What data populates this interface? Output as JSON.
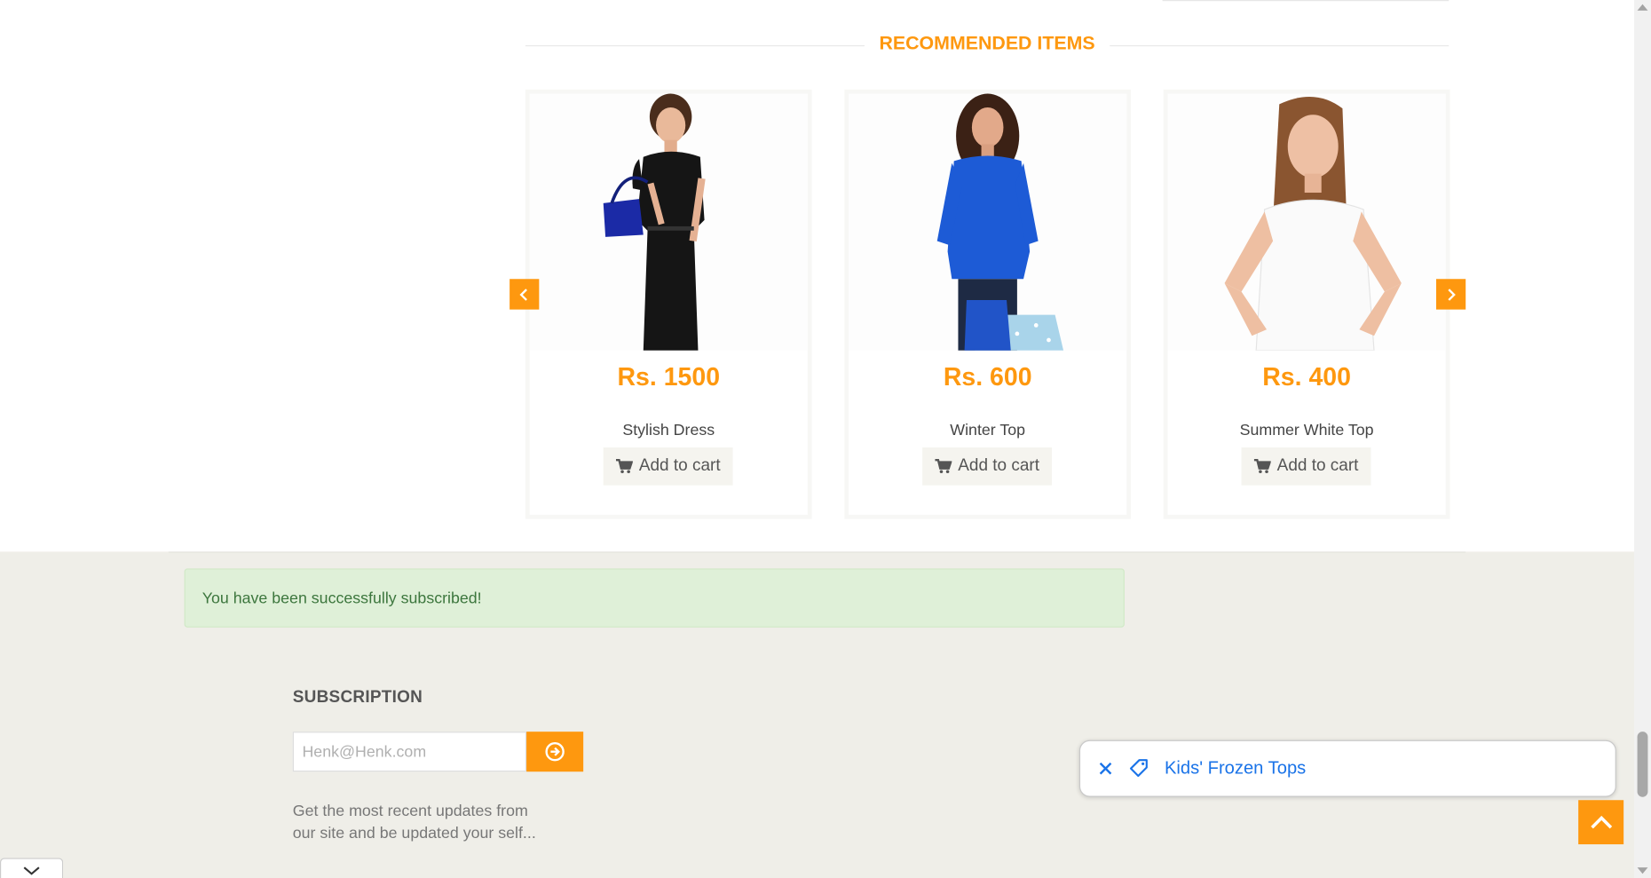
{
  "recommended": {
    "title": "RECOMMENDED ITEMS",
    "products": [
      {
        "price": "Rs. 1500",
        "name": "Stylish Dress",
        "cart_label": "Add to cart"
      },
      {
        "price": "Rs. 600",
        "name": "Winter Top",
        "cart_label": "Add to cart"
      },
      {
        "price": "Rs. 400",
        "name": "Summer White Top",
        "cart_label": "Add to cart"
      }
    ]
  },
  "alert": {
    "message": "You have been successfully subscribed!"
  },
  "subscription": {
    "title": "SUBSCRIPTION",
    "placeholder": "Henk@Henk.com",
    "description": "Get the most recent updates from our site and be updated your self..."
  },
  "chip": {
    "label": "Kids' Frozen Tops"
  },
  "colors": {
    "accent": "#fe980f",
    "alert_bg": "#dff0d8",
    "alert_text": "#3c763d",
    "footer_bg": "#efeee8",
    "link_blue": "#1a73e8"
  },
  "icons": [
    "chevron-left-icon",
    "chevron-right-icon",
    "cart-icon",
    "arrow-circle-right-icon",
    "close-icon",
    "tag-icon",
    "chevron-up-icon",
    "chevron-down-icon"
  ]
}
